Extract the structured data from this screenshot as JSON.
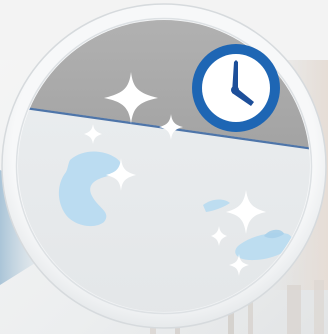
{
  "scene": {
    "subject": "clean-floor-badge",
    "colors": {
      "backdrop_light": "#f2f3f4",
      "backdrop_warm": "#e7e1dc",
      "backdrop_blue": "#a9c7da",
      "ring": "#f4f5f6",
      "ring_shadow": "#d4d8db",
      "floor_light": "#e9ecef",
      "wall_gray": "#a9a9a9",
      "baseboard_line": "#4d74a8",
      "water_blue": "#b9dbf0",
      "sparkle": "#ffffff",
      "clock_blue": "#1e66b4",
      "clock_face": "#ffffff",
      "clock_hands": "#1e4f99"
    },
    "icons": [
      "sparkle-icon",
      "clock-icon",
      "water-spill"
    ]
  }
}
